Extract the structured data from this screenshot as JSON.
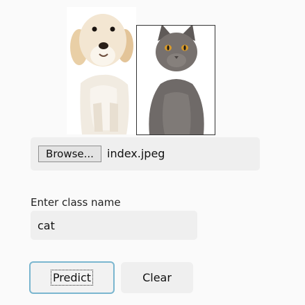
{
  "preview": {
    "images": [
      "dog-photo",
      "cat-photo"
    ]
  },
  "file_picker": {
    "browse_label": "Browse...",
    "file_name": "index.jpeg"
  },
  "class_field": {
    "label": "Enter class name",
    "value": "cat"
  },
  "actions": {
    "predict_label": "Predict",
    "clear_label": "Clear"
  },
  "colors": {
    "focus_border": "#7ab6cf",
    "field_background": "#efefef",
    "page_background": "#fafafa"
  }
}
